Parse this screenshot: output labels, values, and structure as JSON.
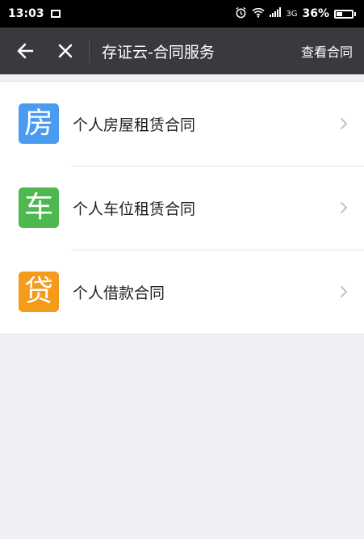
{
  "status_bar": {
    "time": "13:03",
    "network": "3G",
    "battery": "36%",
    "battery_level": 0.36
  },
  "nav": {
    "title": "存证云-合同服务",
    "action_label": "查看合同",
    "icons": {
      "back": "back-arrow-icon",
      "close": "close-icon"
    }
  },
  "contracts": {
    "items": [
      {
        "icon_char": "房",
        "icon_color": "#4a9bef",
        "label": "个人房屋租赁合同"
      },
      {
        "icon_char": "车",
        "icon_color": "#4cb84e",
        "label": "个人车位租赁合同"
      },
      {
        "icon_char": "贷",
        "icon_color": "#f59b1c",
        "label": "个人借款合同"
      }
    ]
  },
  "colors": {
    "nav_background": "#393a3f",
    "page_background": "#efeff4"
  }
}
